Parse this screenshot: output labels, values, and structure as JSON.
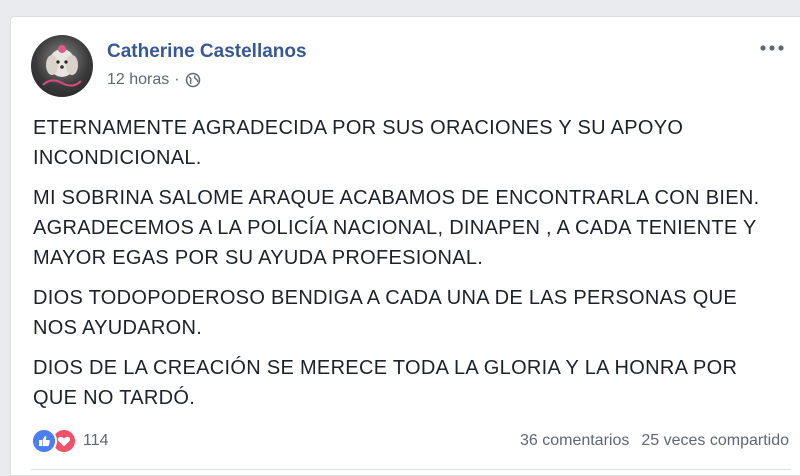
{
  "post": {
    "author": "Catherine Castellanos",
    "time": "12 horas",
    "separator": "·",
    "paragraphs": [
      "ETERNAMENTE AGRADECIDA POR SUS ORACIONES Y SU APOYO INCONDICIONAL.",
      "MI SOBRINA SALOME ARAQUE ACABAMOS DE ENCONTRARLA CON BIEN. AGRADECEMOS A LA POLICÍA NACIONAL, DINAPEN , A CADA TENIENTE Y MAYOR EGAS POR SU AYUDA PROFESIONAL.",
      "DIOS TODOPODEROSO BENDIGA A CADA UNA DE LAS PERSONAS QUE NOS AYUDARON.",
      "DIOS DE LA CREACIÓN SE MERECE TODA LA GLORIA Y LA HONRA POR QUE NO TARDÓ."
    ]
  },
  "stats": {
    "reaction_count": "114",
    "comments": "36 comentarios",
    "shares": "25 veces compartido"
  },
  "icons": {
    "privacy": "globe-icon",
    "more": "more-options-icon",
    "like": "like-reaction-icon",
    "love": "love-reaction-icon"
  },
  "colors": {
    "author_link": "#365899",
    "like_blue": "#4a7ff0",
    "love_red": "#f25268"
  }
}
